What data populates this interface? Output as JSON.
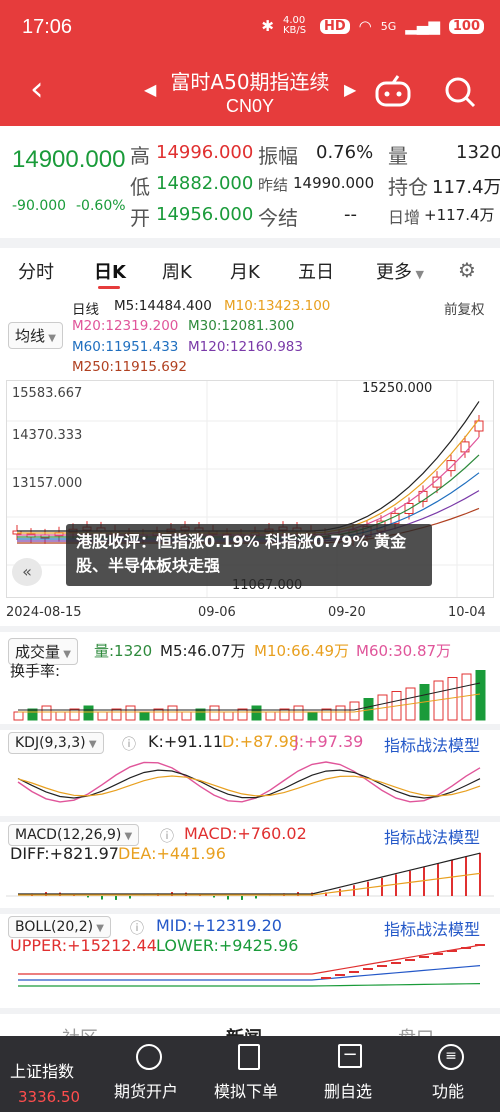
{
  "status": {
    "time": "17:06",
    "net_speed": "4.00 KB/S",
    "hd": "HD",
    "signal": "5G",
    "battery": "100"
  },
  "header": {
    "title": "富时A50期指连续",
    "code": "CN0Y"
  },
  "quote": {
    "price": "14900.000",
    "change": "-90.000",
    "change_pct": "-0.60%",
    "high_label": "高",
    "high": "14996.000",
    "low_label": "低",
    "low": "14882.000",
    "open_label": "开",
    "open": "14956.000",
    "amp_label": "振幅",
    "amp": "0.76%",
    "prev_settle_label": "昨结",
    "prev_settle": "14990.000",
    "settle_label": "今结",
    "settle": "--",
    "vol_label": "量",
    "vol": "1320",
    "oi_label": "持仓",
    "oi": "117.4万",
    "daily_inc_label": "日增",
    "daily_inc": "+117.4万"
  },
  "tabs": [
    "分时",
    "日K",
    "周K",
    "月K",
    "五日",
    "更多"
  ],
  "ma": {
    "line_type": "均线",
    "period": "日线",
    "adjust": "前复权",
    "m5": "M5:14484.400",
    "m10": "M10:13423.100",
    "m20": "M20:12319.200",
    "m30": "M30:12081.300",
    "m60": "M60:11951.433",
    "m120": "M120:12160.983",
    "m250": "M250:11915.692"
  },
  "kchart": {
    "y_ticks": [
      "15583.667",
      "14370.333",
      "13157.000"
    ],
    "x_ticks": [
      "2024-08-15",
      "09-06",
      "09-20",
      "10-04"
    ],
    "max_label": "15250.000",
    "min_label": "11067.000"
  },
  "news": "港股收评：恒指涨0.19% 科指涨0.79% 黄金股、半导体板块走强",
  "volume": {
    "title": "成交量",
    "turnover": "换手率:",
    "vol": "量:1320",
    "m5": "M5:46.07万",
    "m10": "M10:66.49万",
    "m60": "M60:30.87万"
  },
  "kdj": {
    "title": "KDJ(9,3,3)",
    "k": "K:+91.11",
    "d": "D:+87.98",
    "j": "J:+97.39",
    "model": "指标战法模型"
  },
  "macd": {
    "title": "MACD(12,26,9)",
    "macd": "MACD:+760.02",
    "diff": "DIFF:+821.97",
    "dea": "DEA:+441.96",
    "model": "指标战法模型"
  },
  "boll": {
    "title": "BOLL(20,2)",
    "mid": "MID:+12319.20",
    "upper": "UPPER:+15212.44",
    "lower": "LOWER:+9425.96",
    "model": "指标战法模型"
  },
  "bottom_tabs": [
    "社区",
    "新闻",
    "盘口"
  ],
  "nav": {
    "index_name": "上证指数",
    "index_value": "3336.50",
    "items": [
      "期货开户",
      "模拟下单",
      "删自选",
      "功能"
    ]
  }
}
